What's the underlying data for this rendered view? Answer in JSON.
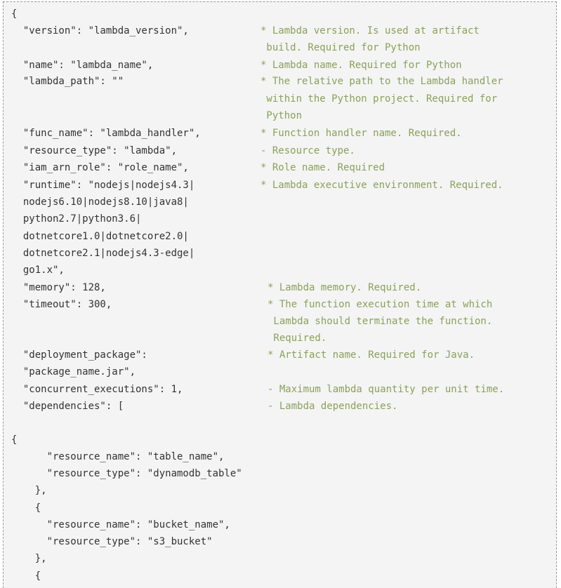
{
  "code_lines": [
    "{",
    "  \"version\": \"lambda_version\",",
    "  \"name\": \"lambda_name\",",
    "  \"lambda_path\": \"\"",
    "  \"func_name\": \"lambda_handler\",",
    "  \"resource_type\": \"lambda\",",
    "  \"iam_arn_role\": \"role_name\",",
    "  \"runtime\": \"nodejs|nodejs4.3|",
    "  nodejs6.10|nodejs8.10|java8|",
    "  python2.7|python3.6|",
    "  dotnetcore1.0|dotnetcore2.0|",
    "  dotnetcore2.1|nodejs4.3-edge|",
    "  go1.x\",",
    "  \"memory\": 128,",
    "  \"timeout\": 300,",
    "  \"deployment_package\":",
    "  \"package_name.jar\",",
    "  \"concurrent_executions\": 1,",
    "  \"dependencies\": [",
    "{",
    "      \"resource_name\": \"table_name\",",
    "      \"resource_type\": \"dynamodb_table\"",
    "    },",
    "    {",
    "      \"resource_name\": \"bucket_name\",",
    "      \"resource_type\": \"s3_bucket\"",
    "    },",
    "    {"
  ],
  "comment_lines": [
    "* Lambda version. Is used at artifact",
    " build. Required for Python",
    "* Lambda name. Required for Python",
    "* The relative path to the Lambda handler",
    " within the Python project. Required for",
    " Python",
    "* Function handler name. Required.",
    "- Resource type.",
    "* Role name. Required",
    "* Lambda executive environment. Required.",
    "* Lambda memory. Required.",
    "* The function execution time at which",
    " Lambda should terminate the function.",
    " Required.",
    "* Artifact name. Required for Java.",
    "- Maximum lambda quantity per unit time.",
    "- Lambda dependencies."
  ]
}
